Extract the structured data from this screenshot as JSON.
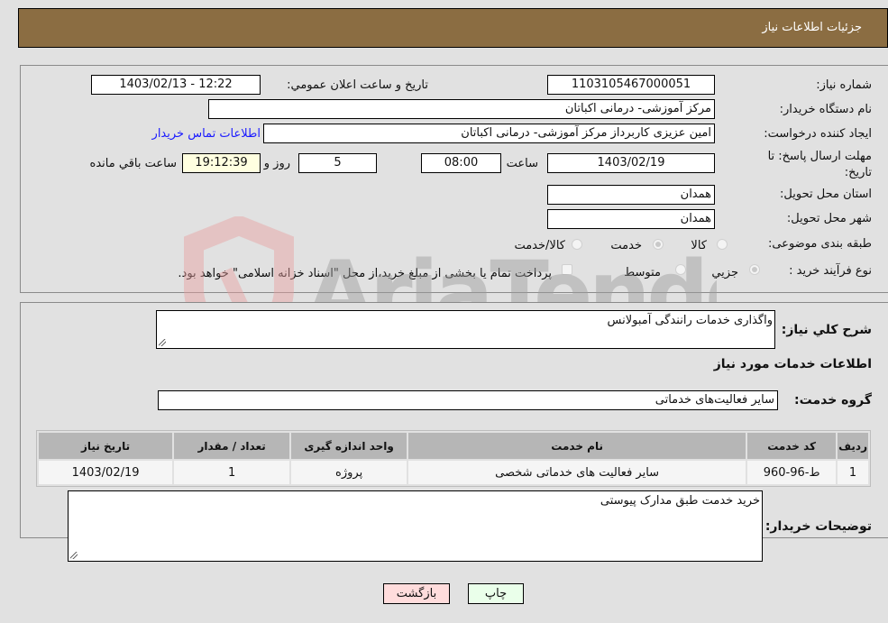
{
  "header": {
    "title": "جزئیات اطلاعات نیاز"
  },
  "form": {
    "need_number": {
      "label": "شماره نیاز:",
      "value": "1103105467000051"
    },
    "announce_datetime": {
      "label": "تاریخ و ساعت اعلان عمومي:",
      "value": "1403/02/13 - 12:22"
    },
    "buyer_org": {
      "label": "نام دستگاه خریدار:",
      "value": "مرکز آموزشی- درمانی اکباتان"
    },
    "requester": {
      "label": "ایجاد کننده درخواست:",
      "value": "امین عزیزی کاربرداز مرکز آموزشی- درمانی اکباتان"
    },
    "buyer_contact_link": "اطلاعات تماس خریدار",
    "deadline": {
      "label_line1": "مهلت ارسال پاسخ: تا",
      "label_line2": "تاریخ:",
      "date": "1403/02/19",
      "time_label": "ساعت",
      "time": "08:00",
      "days": "5",
      "days_label": "روز و",
      "remaining": "19:12:39",
      "remaining_label": "ساعت باقي مانده"
    },
    "province": {
      "label": "استان محل تحویل:",
      "value": "همدان"
    },
    "city": {
      "label": "شهر محل تحویل:",
      "value": "همدان"
    },
    "category": {
      "label": "طبقه بندی موضوعی:",
      "options": [
        "کالا",
        "خدمت",
        "کالا/خدمت"
      ],
      "selected": "خدمت"
    },
    "purchase_type": {
      "label": "نوع فرآیند خرید :",
      "options": [
        "جزيي",
        "متوسط"
      ],
      "selected": "جزيي",
      "note": "پرداخت تمام یا بخشی از مبلغ خرید،از محل \"اسناد خزانه اسلامی\" خواهد بود."
    }
  },
  "details": {
    "summary_label": "شرح کلي نیاز:",
    "summary_value": "واگذاری خدمات رانندگی آمبولانس",
    "services_heading": "اطلاعات خدمات مورد نیاز",
    "service_group_label": "گروه خدمت:",
    "service_group_value": "سایر فعالیت‌های خدماتی",
    "table": {
      "headers": [
        "ردیف",
        "کد خدمت",
        "نام خدمت",
        "واحد اندازه گیری",
        "تعداد / مقدار",
        "تاریخ نیاز"
      ],
      "rows": [
        [
          "1",
          "ط-96-960",
          "سایر فعالیت های خدماتی شخصی",
          "پروژه",
          "1",
          "1403/02/19"
        ]
      ]
    },
    "buyer_notes_label": "توضیحات خریدار:",
    "buyer_notes_value": "خرید خدمت طبق مدارک پیوستی"
  },
  "buttons": {
    "print": "چاپ",
    "back": "بازگشت"
  },
  "watermark": {
    "text": "AriaTender.neT"
  },
  "colors": {
    "header_bg": "#8b6d42",
    "link": "#1a1aff",
    "back_btn": "#ffdcdc",
    "print_btn": "#eaffea"
  }
}
